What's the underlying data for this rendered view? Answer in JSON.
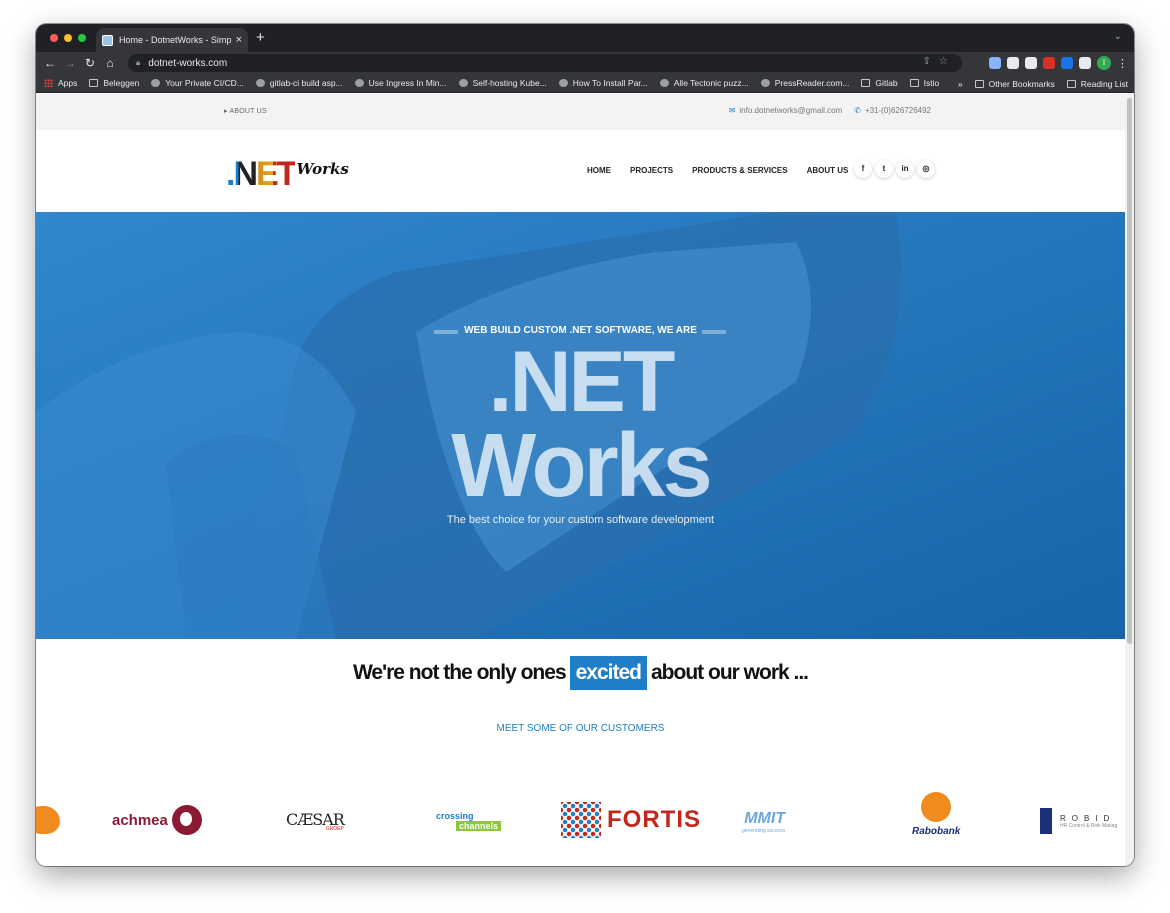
{
  "browser": {
    "tab_title": "Home - DotnetWorks - Simple",
    "tab_close": "×",
    "new_tab": "+",
    "url": "dotnet-works.com",
    "profile_initial": "I",
    "bookmarks": [
      {
        "label": "Apps",
        "icon": "apps-grid-icon"
      },
      {
        "label": "Beleggen",
        "icon": "folder-icon"
      },
      {
        "label": "Your Private CI/CD...",
        "icon": "codefresh-icon"
      },
      {
        "label": "gitlab-ci build asp...",
        "icon": "gitlab-icon"
      },
      {
        "label": "Use Ingress In Min...",
        "icon": "medium-icon"
      },
      {
        "label": "Self-hosting Kube...",
        "icon": "kube-icon"
      },
      {
        "label": "How To Install Par...",
        "icon": "digitalocean-icon"
      },
      {
        "label": "Alle Tectonic puzz...",
        "icon": "puzzle-icon"
      },
      {
        "label": "PressReader.com...",
        "icon": "pressreader-icon"
      },
      {
        "label": "Gitlab",
        "icon": "folder-icon"
      },
      {
        "label": "Istio",
        "icon": "folder-icon"
      }
    ],
    "bookmarks_overflow": "»",
    "other_bookmarks": "Other Bookmarks",
    "reading_list": "Reading List"
  },
  "topbar": {
    "about_link": "ABOUT US",
    "email": "info.dotnetworks@gmail.com",
    "phone": "+31-(0)626726492"
  },
  "header": {
    "logo_net": ".NET",
    "logo_works": "Works",
    "nav": [
      "HOME",
      "PROJECTS",
      "PRODUCTS & SERVICES",
      "ABOUT US"
    ],
    "social": [
      {
        "glyph": "f",
        "icon": "facebook-icon"
      },
      {
        "glyph": "t",
        "icon": "twitter-icon"
      },
      {
        "glyph": "in",
        "icon": "linkedin-icon"
      },
      {
        "glyph": "◎",
        "icon": "instagram-icon"
      }
    ]
  },
  "hero": {
    "tagline": "WEB BUILD CUSTOM .NET SOFTWARE, WE ARE",
    "title_line1": ".NET",
    "title_line2": "Works",
    "subtitle": "The best choice for your custom software development",
    "bg_color": "#1f76bf"
  },
  "customers": {
    "title_before": "We're not the only ones",
    "title_highlight": "excited",
    "title_after": "about our work ...",
    "subtitle": "MEET SOME OF OUR CUSTOMERS",
    "logos": {
      "achmea": "achmea",
      "caesar": "CÆSAR",
      "caesar_sub": "GROEP",
      "crossing_line1": "crossing",
      "crossing_line2": "channels",
      "fortis": "FORTIS",
      "mmit": "MMIT",
      "mmit_sub": "generating success",
      "rabobank": "Rabobank",
      "robid": "ROBID",
      "robid_sub": "HR Control & Risk Manag"
    }
  },
  "colors": {
    "accent": "#1e7fc8",
    "dark": "#111111"
  }
}
